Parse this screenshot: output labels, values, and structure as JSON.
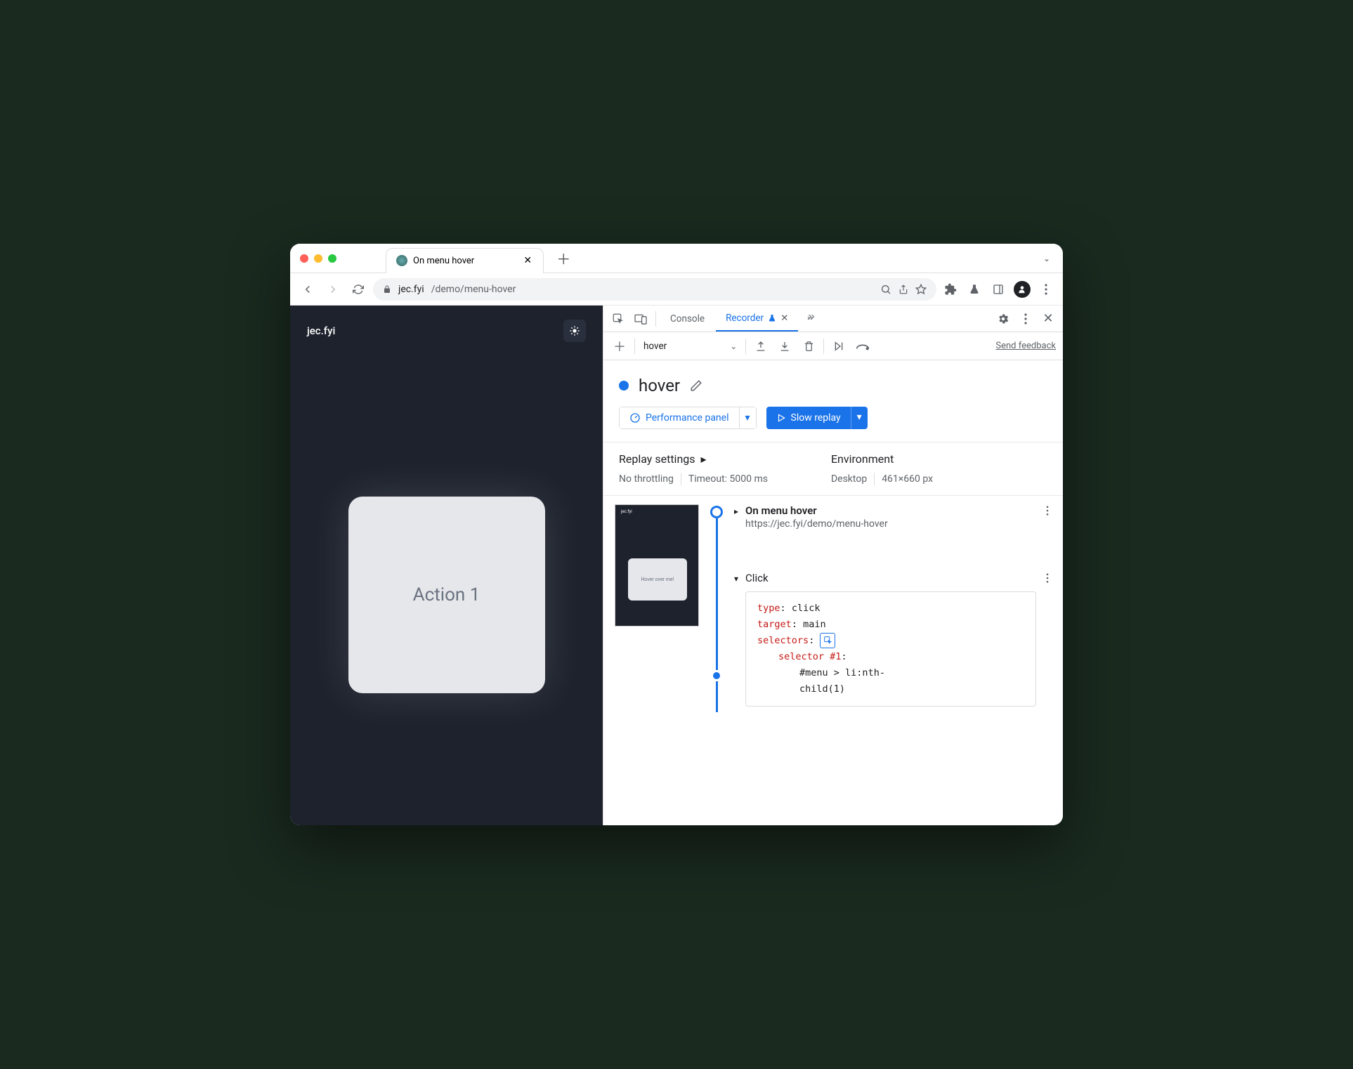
{
  "browser": {
    "tab_title": "On menu hover",
    "url_domain": "jec.fyi",
    "url_path": "/demo/menu-hover"
  },
  "page": {
    "site_title": "jec.fyi",
    "card_text": "Action 1",
    "thumb_card_text": "Hover over me!"
  },
  "devtools": {
    "tabs": {
      "console": "Console",
      "recorder": "Recorder"
    },
    "recorder": {
      "dropdown_name": "hover",
      "send_feedback": "Send feedback",
      "recording_name": "hover",
      "perf_button": "Performance panel",
      "replay_button": "Slow replay",
      "settings": {
        "replay_title": "Replay settings",
        "throttling": "No throttling",
        "timeout": "Timeout: 5000 ms",
        "env_title": "Environment",
        "device": "Desktop",
        "viewport": "461×660 px"
      },
      "steps": {
        "start": {
          "title": "On menu hover",
          "url": "https://jec.fyi/demo/menu-hover"
        },
        "click": {
          "title": "Click",
          "props": {
            "type_key": "type",
            "type_val": "click",
            "target_key": "target",
            "target_val": "main",
            "selectors_key": "selectors",
            "selector_num": "selector #1",
            "selector_line": "#menu > li:nth-",
            "selector_line2": "child(1)"
          }
        }
      }
    }
  }
}
